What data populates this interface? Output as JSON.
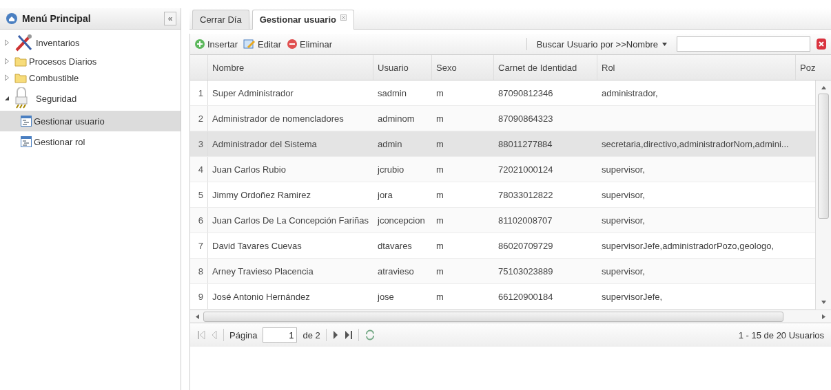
{
  "sidebar": {
    "title": "Menú Principal",
    "collapse_label": "«",
    "items": [
      {
        "label": "Inventarios",
        "kind": "tools",
        "expanded": false,
        "selected": false
      },
      {
        "label": "Procesos Diarios",
        "kind": "folder",
        "expanded": false,
        "selected": false
      },
      {
        "label": "Combustible",
        "kind": "folder",
        "expanded": false,
        "selected": false
      },
      {
        "label": "Seguridad",
        "kind": "lock",
        "expanded": true,
        "selected": false,
        "children": [
          {
            "label": "Gestionar usuario",
            "kind": "leaf",
            "selected": true
          },
          {
            "label": "Gestionar rol",
            "kind": "leaf",
            "selected": false
          }
        ]
      }
    ]
  },
  "tabs": [
    {
      "label": "Cerrar Día",
      "selected": false,
      "closable": false
    },
    {
      "label": "Gestionar usuario",
      "selected": true,
      "closable": true
    }
  ],
  "toolbar": {
    "buttons": [
      {
        "label": "Insertar",
        "kind": "add"
      },
      {
        "label": "Editar",
        "kind": "edit"
      },
      {
        "label": "Eliminar",
        "kind": "remove"
      }
    ],
    "search_label": "Buscar Usuario por >>Nombre"
  },
  "table": {
    "columns": [
      "Nombre",
      "Usuario",
      "Sexo",
      "Carnet de Identidad",
      "Rol",
      "Poz"
    ],
    "rows": [
      {
        "number": "1",
        "cells": [
          "Super Administrador",
          "sadmin",
          "m",
          "87090812346",
          "administrador,"
        ],
        "selected": false
      },
      {
        "number": "2",
        "cells": [
          "Administrador de nomencladores",
          "adminom",
          "m",
          "87090864323",
          ""
        ],
        "selected": false
      },
      {
        "number": "3",
        "cells": [
          "Administrador del Sistema",
          "admin",
          "m",
          "88011277884",
          "secretaria,directivo,administradorNom,admini..."
        ],
        "selected": true
      },
      {
        "number": "4",
        "cells": [
          "Juan Carlos Rubio",
          "jcrubio",
          "m",
          "72021000124",
          "supervisor,"
        ],
        "selected": false
      },
      {
        "number": "5",
        "cells": [
          "Jimmy Ordoñez Ramirez",
          "jora",
          "m",
          "78033012822",
          "supervisor,"
        ],
        "selected": false
      },
      {
        "number": "6",
        "cells": [
          "Juan Carlos De La Concepción Fariñas",
          "jconcepcion",
          "m",
          "81102008707",
          "supervisor,"
        ],
        "selected": false
      },
      {
        "number": "7",
        "cells": [
          "David Tavares Cuevas",
          "dtavares",
          "m",
          "86020709729",
          "supervisorJefe,administradorPozo,geologo,"
        ],
        "selected": false
      },
      {
        "number": "8",
        "cells": [
          "Arney Travieso Placencia",
          "atravieso",
          "m",
          "75103023889",
          "supervisor,"
        ],
        "selected": false
      },
      {
        "number": "9",
        "cells": [
          "José Antonio Hernández",
          "jose",
          "m",
          "66120900184",
          "supervisorJefe,"
        ],
        "selected": false
      }
    ]
  },
  "pager": {
    "page_label": "Página",
    "page": "1",
    "of_label": "de 2",
    "summary": "1 - 15 de 20 Usuarios"
  }
}
